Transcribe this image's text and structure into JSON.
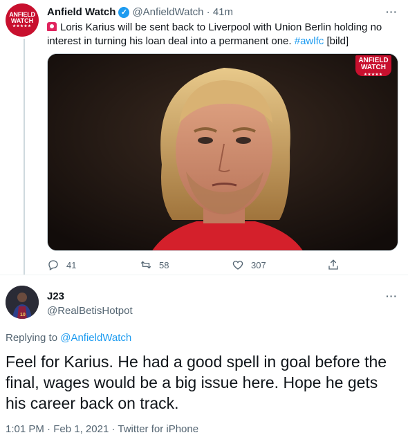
{
  "tweet": {
    "avatar_text_line1": "ANFIELD",
    "avatar_text_line2": "WATCH",
    "display_name": "Anfield Watch",
    "handle": "@AnfieldWatch",
    "time": "41m",
    "text_main": "Loris Karius will be sent back to Liverpool with Union Berlin holding no interest in turning his loan deal into a permanent one.",
    "hashtag": "#awlfc",
    "tag": "[bild]",
    "media_badge_line1": "ANFIELD",
    "media_badge_line2": "WATCH",
    "actions": {
      "replies": "41",
      "retweets": "58",
      "likes": "307"
    }
  },
  "reply": {
    "display_name": "J23",
    "handle": "@RealBetisHotpot",
    "replying_to_prefix": "Replying to",
    "replying_to_handle": "@AnfieldWatch",
    "text": "Feel for Karius. He had a good spell in goal before the final, wages would be a big issue here. Hope he gets his career back on track.",
    "time": "1:01 PM",
    "date": "Feb 1, 2021",
    "source": "Twitter for iPhone"
  },
  "colors": {
    "accent": "#1d9bf0",
    "brand_red": "#c8102e",
    "muted": "#536471"
  },
  "icons": [
    "verified-badge-icon",
    "siren-emoji-icon",
    "reply-icon",
    "retweet-icon",
    "like-icon",
    "share-icon",
    "more-icon"
  ]
}
